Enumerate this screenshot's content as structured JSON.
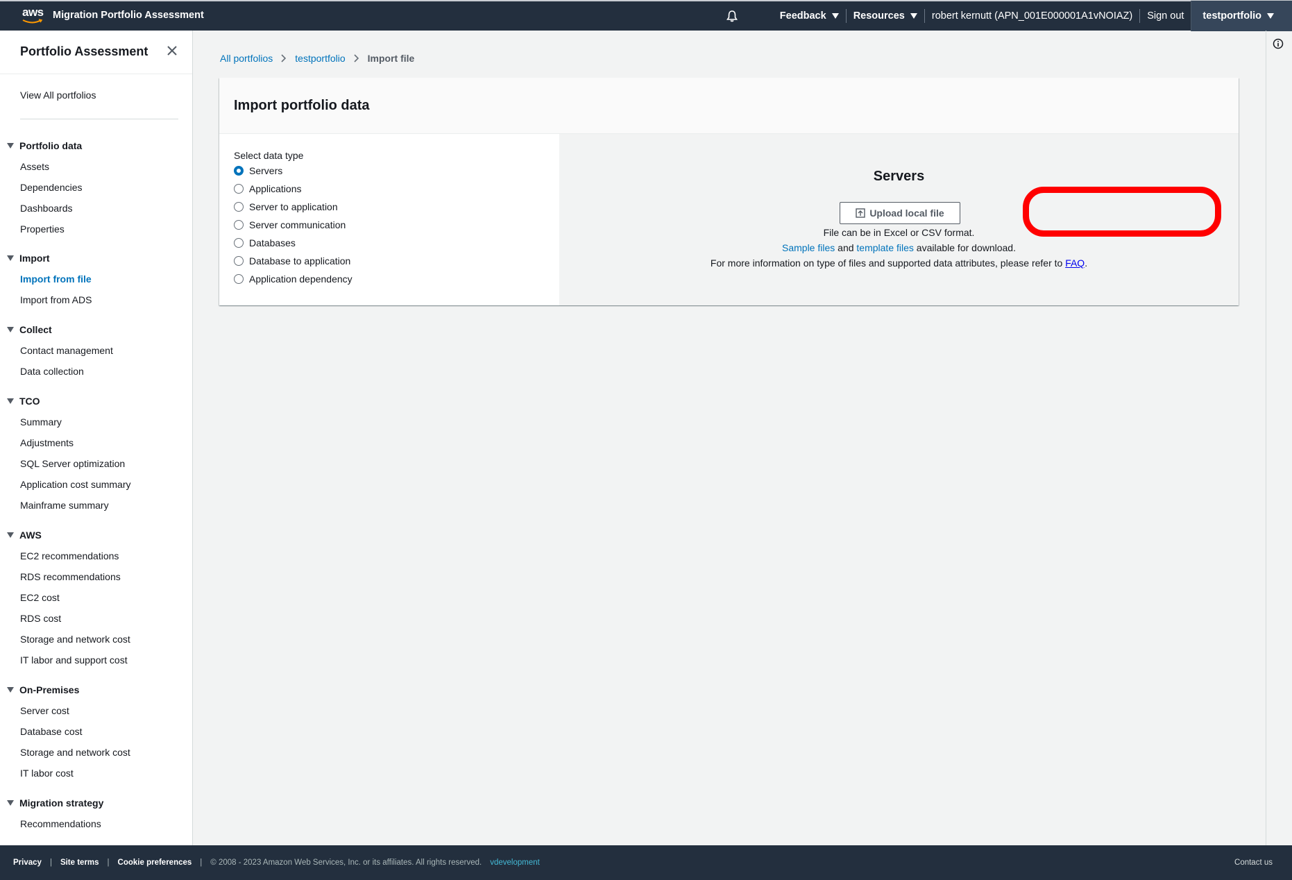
{
  "topnav": {
    "logo_text": "aws",
    "app_title": "Migration Portfolio Assessment",
    "feedback": "Feedback",
    "resources": "Resources",
    "user": "robert kernutt (APN_001E000001A1vNOIAZ)",
    "sign_out": "Sign out",
    "portfolio": "testportfolio"
  },
  "sidebar": {
    "title": "Portfolio Assessment",
    "view_all": "View All portfolios",
    "sections": [
      {
        "title": "Portfolio data",
        "items": [
          "Assets",
          "Dependencies",
          "Dashboards",
          "Properties"
        ]
      },
      {
        "title": "Import",
        "items": [
          "Import from file",
          "Import from ADS"
        ]
      },
      {
        "title": "Collect",
        "items": [
          "Contact management",
          "Data collection"
        ]
      },
      {
        "title": "TCO",
        "items": [
          "Summary",
          "Adjustments",
          "SQL Server optimization",
          "Application cost summary",
          "Mainframe summary"
        ]
      },
      {
        "title": "AWS",
        "items": [
          "EC2 recommendations",
          "RDS recommendations",
          "EC2 cost",
          "RDS cost",
          "Storage and network cost",
          "IT labor and support cost"
        ]
      },
      {
        "title": "On-Premises",
        "items": [
          "Server cost",
          "Database cost",
          "Storage and network cost",
          "IT labor cost"
        ]
      },
      {
        "title": "Migration strategy",
        "items": [
          "Recommendations"
        ]
      }
    ],
    "active_item": "Import from file"
  },
  "breadcrumb": {
    "all": "All portfolios",
    "portfolio": "testportfolio",
    "current": "Import file"
  },
  "panel": {
    "title": "Import portfolio data",
    "select_label": "Select data type",
    "options": [
      "Servers",
      "Applications",
      "Server to application",
      "Server communication",
      "Databases",
      "Database to application",
      "Application dependency"
    ],
    "selected": "Servers",
    "right_title": "Servers",
    "upload_label": "Upload local file",
    "format_note": "File can be in Excel or CSV format.",
    "sample_link": "Sample files",
    "and_text": " and ",
    "template_link": "template files",
    "download_text": " available for download.",
    "more_info": "For more information on type of files and supported data attributes, please refer to ",
    "faq": "FAQ",
    "period": "."
  },
  "footer": {
    "privacy": "Privacy",
    "site_terms": "Site terms",
    "cookie": "Cookie preferences",
    "copyright": "© 2008 - 2023 Amazon Web Services, Inc. or its affiliates. All rights reserved.",
    "env": "vdevelopment",
    "contact": "Contact us"
  },
  "colors": {
    "nav_bg": "#232f3e",
    "link": "#0073bb",
    "highlight": "#ff0000"
  }
}
